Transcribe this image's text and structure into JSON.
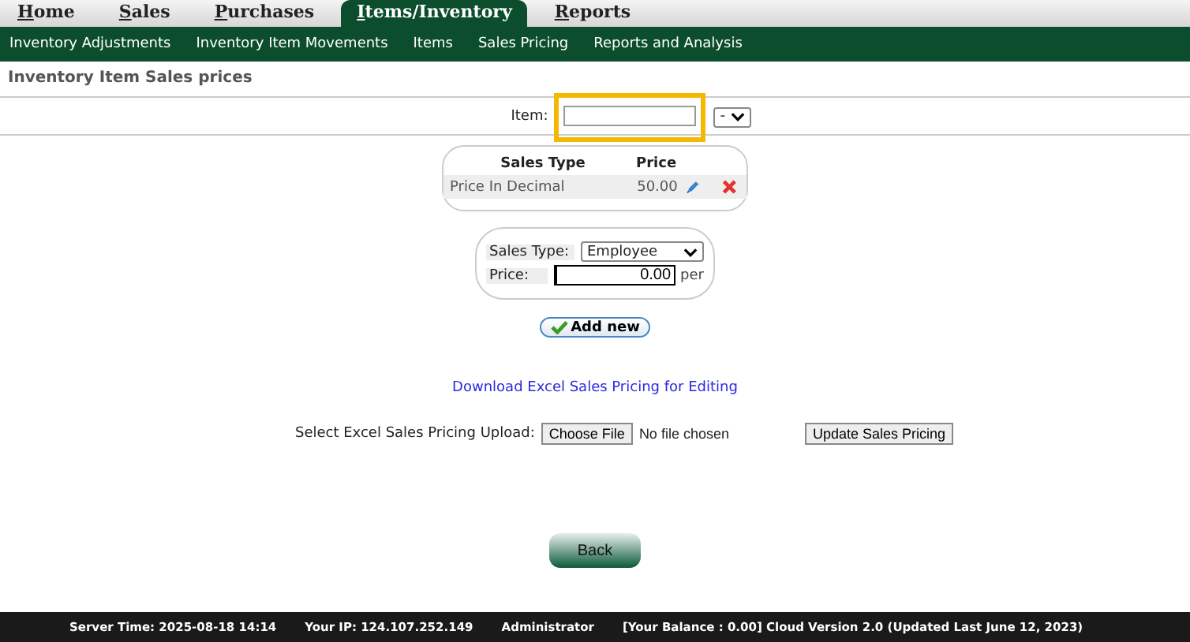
{
  "top_tabs": [
    {
      "label": "Home",
      "selected": false
    },
    {
      "label": "Sales",
      "selected": false
    },
    {
      "label": "Purchases",
      "selected": false
    },
    {
      "label": "Items/Inventory",
      "selected": true
    },
    {
      "label": "Reports",
      "selected": false
    }
  ],
  "sub_nav": [
    "Inventory Adjustments",
    "Inventory Item Movements",
    "Items",
    "Sales Pricing",
    "Reports and Analysis"
  ],
  "page_title": "Inventory Item Sales prices",
  "item_filter": {
    "label": "Item:",
    "highlighted": true,
    "select_value": "-"
  },
  "prices_table": {
    "columns": [
      "Sales Type",
      "Price"
    ],
    "rows": [
      {
        "sales_type": "Price In Decimal",
        "price": "50.00"
      }
    ]
  },
  "form": {
    "sales_type_label": "Sales Type:",
    "sales_type_value": "Employee",
    "price_label": "Price:",
    "price_value": "0.00",
    "price_suffix": "per"
  },
  "add_button": "Add new",
  "download_link": "Download Excel Sales Pricing for Editing",
  "upload": {
    "label": "Select Excel Sales Pricing Upload:",
    "choose_button": "Choose File",
    "file_status": "No file chosen",
    "update_button": "Update Sales Pricing"
  },
  "back_button": "Back",
  "footer": [
    "Server Time: 2025-08-18 14:14",
    "Your IP: 124.107.252.149",
    "Administrator",
    "[Your Balance : 0.00] Cloud Version 2.0 (Updated Last June 12, 2023)"
  ]
}
